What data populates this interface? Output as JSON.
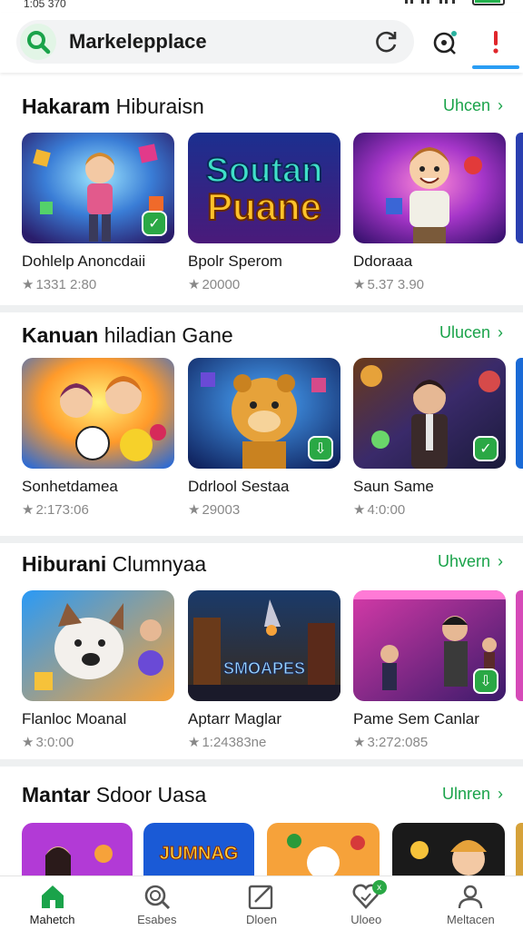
{
  "status": {
    "time": "1:05 370"
  },
  "search": {
    "text": "Markelepplace"
  },
  "sections": [
    {
      "title_bold": "Hakaram",
      "title_rest": " Hiburaisn",
      "more": "Uhcen",
      "cards": [
        {
          "title": "Dohlelp Anoncdaii",
          "rating": "1331 2:80",
          "icon": "puzzle"
        },
        {
          "title": "Bpolr Sperom",
          "rating": "20000",
          "icon": "title-art",
          "art_text_1": "Soutan",
          "art_text_2": "Puane"
        },
        {
          "title": "Ddoraaa",
          "rating": "5.37 3.90",
          "icon": "hero"
        }
      ]
    },
    {
      "title_bold": "Kanuan",
      "title_rest": " hiladian Gane",
      "more": "Ulucen",
      "cards": [
        {
          "title": "Sonhetdamea",
          "rating": "2:173:06",
          "icon": "kids"
        },
        {
          "title": "Ddrlool Sestaa",
          "rating": "29003",
          "icon": "bear"
        },
        {
          "title": "Saun Same",
          "rating": "4:0:00",
          "icon": "casino"
        }
      ]
    },
    {
      "title_bold": "Hiburani",
      "title_rest": " Clumnyaa",
      "more": "Uhvern",
      "cards": [
        {
          "title": "Flanloc Moanal",
          "rating": "3:0:00",
          "icon": "dog"
        },
        {
          "title": "Aptarr Maglar",
          "rating": "1:24383ne",
          "icon": "space",
          "art_text_1": "SMOAPES"
        },
        {
          "title": "Pame Sem Canlar",
          "rating": "3:272:085",
          "icon": "arcade"
        }
      ]
    },
    {
      "title_bold": "Mantar",
      "title_rest": " Sdoor Uasa",
      "more": "Ulnren",
      "cards": [
        {
          "icon": "girl"
        },
        {
          "icon": "title2",
          "art_text_1": "JUMNAG"
        },
        {
          "icon": "bomb"
        },
        {
          "icon": "pirate"
        }
      ]
    }
  ],
  "nav": [
    {
      "label": "Mahetch",
      "icon": "home-icon"
    },
    {
      "label": "Esabes",
      "icon": "search-icon"
    },
    {
      "label": "Dloen",
      "icon": "edit-icon"
    },
    {
      "label": "Uloeo",
      "icon": "heart-icon",
      "dot": "x"
    },
    {
      "label": "Meltacen",
      "icon": "user-icon"
    }
  ],
  "colors": {
    "accent": "#1aa34a",
    "badge": "#2aa845",
    "alert": "#e0262b"
  }
}
